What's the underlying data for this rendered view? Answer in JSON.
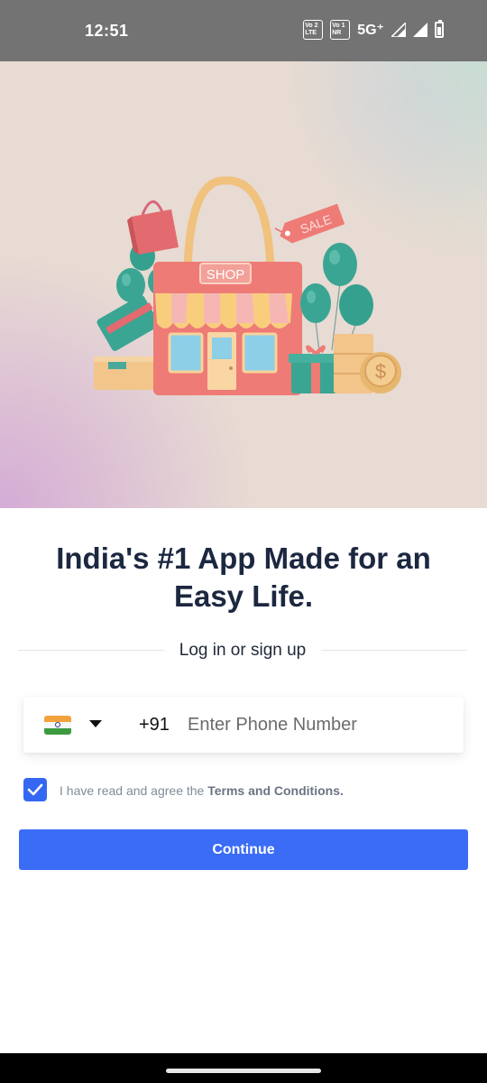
{
  "status_bar": {
    "time": "12:51",
    "sim1": {
      "line1": "Vo 2",
      "line2": "LTE"
    },
    "sim2": {
      "line1": "Vo 1",
      "line2": "NR"
    },
    "network": "5G⁺",
    "icons": [
      "signal-icon",
      "signal-icon",
      "battery-icon"
    ]
  },
  "hero": {
    "illustration": "shop-storefront-illustration",
    "shop_sign": "SHOP",
    "sale_tag": "SALE"
  },
  "headline": "India's #1 App Made for an Easy Life.",
  "divider_text": "Log in or sign up",
  "phone": {
    "country_flag": "india-flag-icon",
    "country_code": "+91",
    "placeholder": "Enter Phone Number",
    "value": ""
  },
  "terms": {
    "checked": true,
    "prefix": "I have read and agree the ",
    "link": "Terms and Conditions."
  },
  "continue_label": "Continue",
  "colors": {
    "primary": "#3a6cf6",
    "heading": "#1c2740",
    "status_bar": "#737373"
  }
}
